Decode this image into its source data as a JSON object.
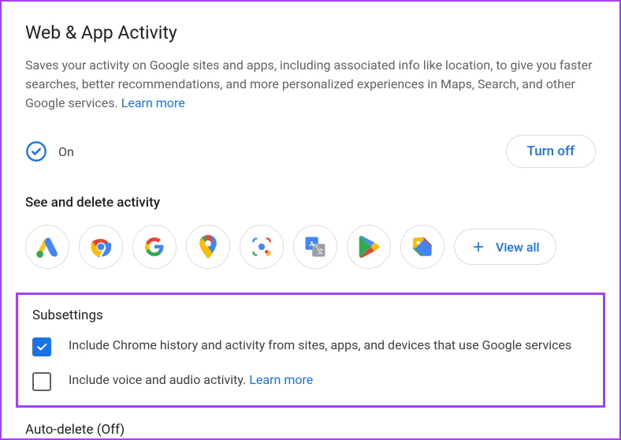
{
  "title": "Web & App Activity",
  "description": "Saves your activity on Google sites and apps, including associated info like location, to give you faster searches, better recommendations, and more personalized experiences in Maps, Search, and other Google services. ",
  "learn_more": "Learn more",
  "status": {
    "label": "On",
    "button": "Turn off"
  },
  "see_delete": {
    "header": "See and delete activity",
    "view_all": "View all",
    "icons": [
      {
        "name": "google-ads-icon"
      },
      {
        "name": "chrome-icon"
      },
      {
        "name": "google-icon"
      },
      {
        "name": "google-maps-icon"
      },
      {
        "name": "google-lens-icon"
      },
      {
        "name": "google-translate-icon"
      },
      {
        "name": "google-play-icon"
      },
      {
        "name": "google-shopping-icon"
      }
    ]
  },
  "subsettings": {
    "header": "Subsettings",
    "items": [
      {
        "checked": true,
        "label": "Include Chrome history and activity from sites, apps, and devices that use Google services",
        "learn_more": false
      },
      {
        "checked": false,
        "label": "Include voice and audio activity. ",
        "learn_more": true
      }
    ]
  },
  "auto_delete": "Auto-delete (Off)"
}
